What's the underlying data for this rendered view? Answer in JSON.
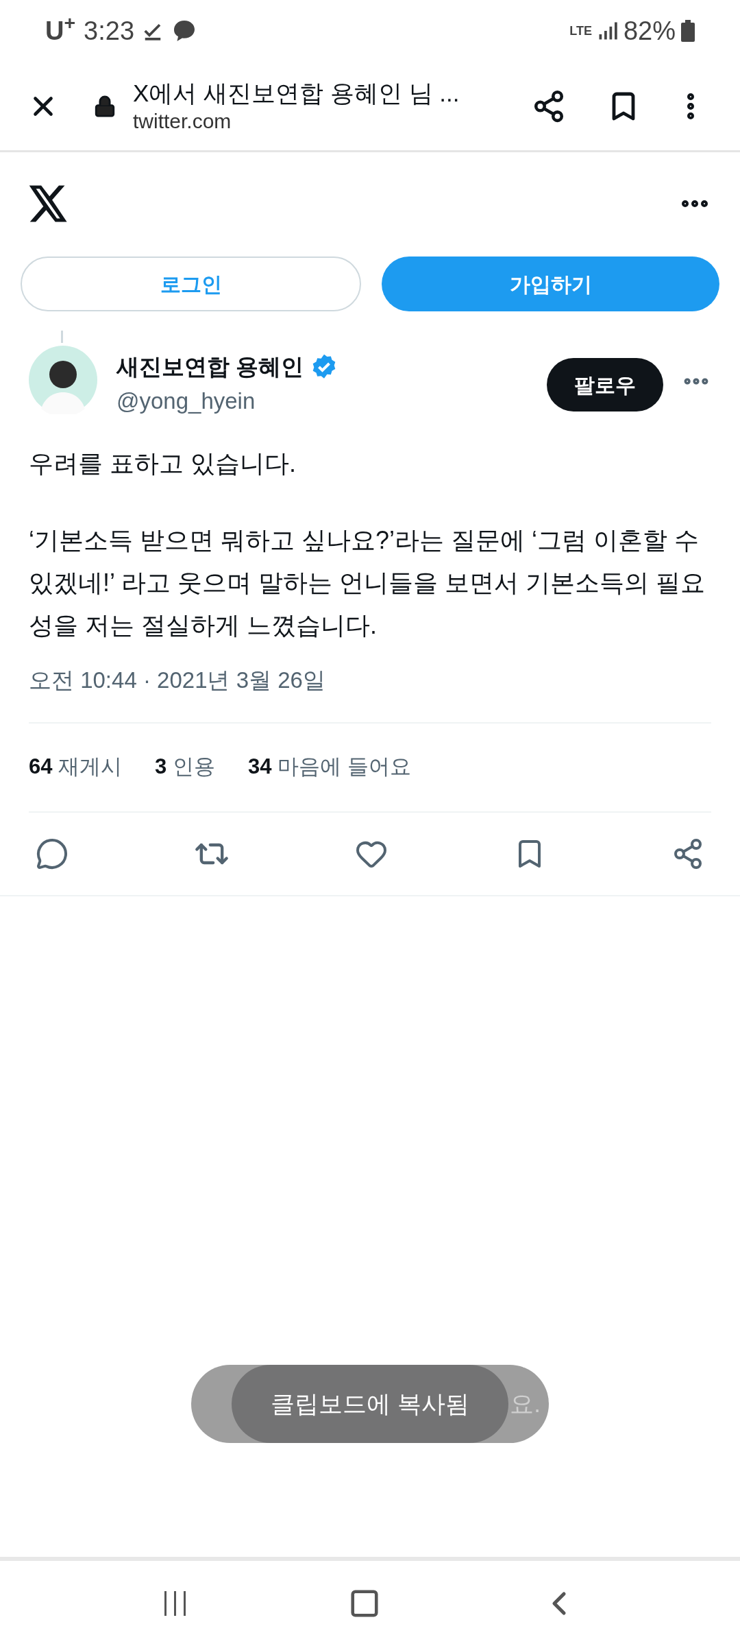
{
  "status_bar": {
    "carrier": "U$^{+}$",
    "time": "3:23",
    "network": "LTE",
    "battery": "82%"
  },
  "browser": {
    "title": "X에서 새진보연합 용혜인 님 ...",
    "url": "twitter.com"
  },
  "auth_buttons": [
    {
      "label": "로그인",
      "kind": "outline"
    },
    {
      "label": "가입하기",
      "kind": "filled"
    }
  ],
  "tweet": {
    "author": "새진보연합 용혜인",
    "verified": true,
    "handle": "@yong_hyein",
    "follow": "팔로우",
    "paragraphs": [
      "우려를 표하고 있습니다.",
      "‘기본소득 받으면 뭐하고 싶나요?’라는 질문에 ‘그럼 이혼할 수 있겠네!’ 라고 웃으며 말하는 언니들을 보면서 기본소득의 필요성을 저는 절실하게 느꼈습니다."
    ],
    "timestamp": "오전 10:44 · 2021년 3월 26일",
    "stats": [
      {
        "count": "64",
        "label": "재게시"
      },
      {
        "count": "3",
        "label": "인용"
      },
      {
        "count": "34",
        "label": "마음에 들어요"
      }
    ]
  },
  "toasts": [
    {
      "text": "클립보드에 복사됨",
      "kind": "front"
    },
    {
      "text": "요.",
      "kind": "back"
    }
  ]
}
